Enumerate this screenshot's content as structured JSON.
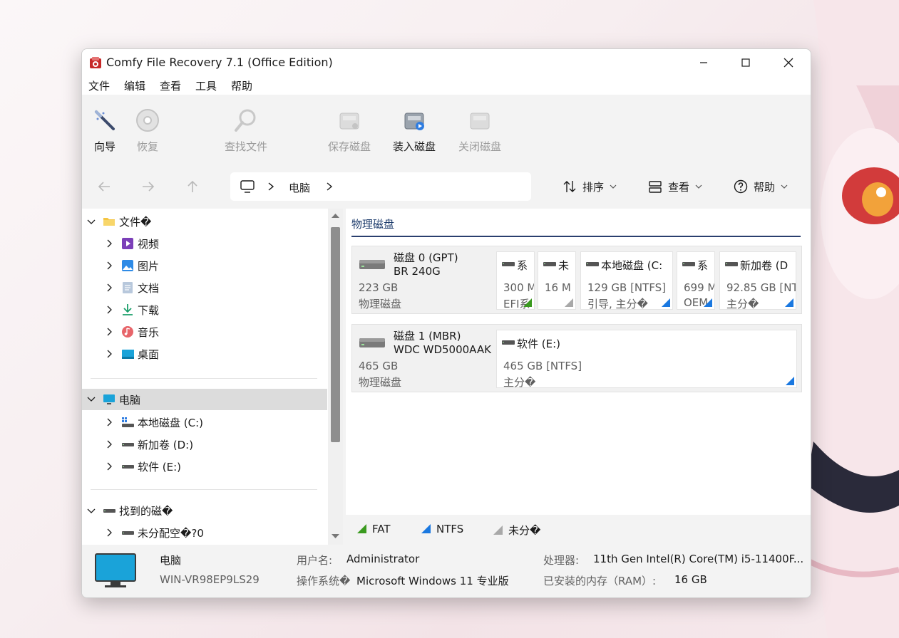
{
  "app": {
    "title": "Comfy File Recovery 7.1 (Office Edition)"
  },
  "menu": [
    "文件",
    "编辑",
    "查看",
    "工具",
    "帮助"
  ],
  "toolbar": {
    "wizard": "向导",
    "recover": "恢复",
    "find_files": "查找文件",
    "save_disk": "保存磁盘",
    "mount_disk": "装入磁盘",
    "close_disk": "关闭磁盘"
  },
  "nav": {
    "breadcrumb": "电脑",
    "sort": "排序",
    "view": "查看",
    "help": "帮助"
  },
  "tree": {
    "folders_root": "文件�",
    "folders": [
      "视频",
      "图片",
      "文档",
      "下载",
      "音乐",
      "桌面"
    ],
    "computer_root": "电脑",
    "drives": [
      "本地磁盘 (C:)",
      "新加卷 (D:)",
      "软件 (E:)"
    ],
    "found_root": "找到的磁�",
    "found": [
      "未分配空�?0"
    ]
  },
  "main": {
    "section_title": "物理磁盘",
    "disks": [
      {
        "name1": "磁盘 0 (GPT)",
        "name2": "BR 240G",
        "size": "223 GB",
        "kind": "物理磁盘",
        "partitions": [
          {
            "name": "系",
            "line1": "300 M",
            "line2": "EFI系",
            "fs_color": "#3a9a1f"
          },
          {
            "name": "未",
            "line1": "16 M",
            "line2": "",
            "fs_color": "#a8a8a8"
          },
          {
            "name": "本地磁盘 (C:",
            "line1": "129 GB [NTFS]",
            "line2": "引导, 主分�",
            "fs_color": "#1a78e0"
          },
          {
            "name": "系",
            "line1": "699 M",
            "line2": "OEM",
            "fs_color": "#1a78e0"
          },
          {
            "name": "新加卷 (D",
            "line1": "92.85 GB [NT",
            "line2": "主分�",
            "fs_color": "#1a78e0"
          }
        ]
      },
      {
        "name1": "磁盘 1 (MBR)",
        "name2": "WDC WD5000AAK",
        "size": "465 GB",
        "kind": "物理磁盘",
        "partitions": [
          {
            "name": "软件 (E:)",
            "line1": "465 GB [NTFS]",
            "line2": "主分�",
            "fs_color": "#1a78e0"
          }
        ]
      }
    ]
  },
  "legend": [
    {
      "label": "FAT",
      "color": "#3a9a1f"
    },
    {
      "label": "NTFS",
      "color": "#1a78e0"
    },
    {
      "label": "未分�",
      "color": "#a8a8a8"
    }
  ],
  "status": {
    "computer_label": "电脑",
    "hostname": "WIN-VR98EP9LS29",
    "user_key": "用户名:",
    "user_val": "Administrator",
    "os_key": "操作系统�",
    "os_val": "Microsoft Windows 11 专业版",
    "cpu_key": "处理器:",
    "cpu_val": "11th Gen Intel(R) Core(TM) i5-11400F...",
    "ram_key": "已安装的内存（RAM）:",
    "ram_val": "16 GB"
  }
}
